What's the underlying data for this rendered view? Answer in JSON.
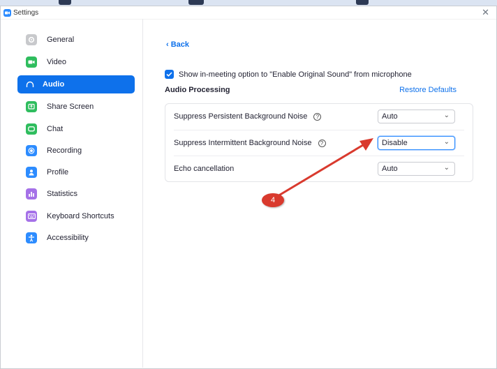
{
  "window": {
    "title": "Settings"
  },
  "sidebar": {
    "items": [
      {
        "label": "General",
        "icon": "gear-icon",
        "color": "#c8c9cc"
      },
      {
        "label": "Video",
        "icon": "video-camera-icon",
        "color": "#2fbd5e"
      },
      {
        "label": "Audio",
        "icon": "headphones-icon",
        "color": "#0e71eb",
        "active": true
      },
      {
        "label": "Share Screen",
        "icon": "share-screen-icon",
        "color": "#2fbd5e"
      },
      {
        "label": "Chat",
        "icon": "chat-bubble-icon",
        "color": "#2fbd5e"
      },
      {
        "label": "Recording",
        "icon": "record-icon",
        "color": "#2d8cff"
      },
      {
        "label": "Profile",
        "icon": "person-icon",
        "color": "#2d8cff"
      },
      {
        "label": "Statistics",
        "icon": "bar-chart-icon",
        "color": "#a571e8"
      },
      {
        "label": "Keyboard Shortcuts",
        "icon": "keyboard-icon",
        "color": "#a571e8"
      },
      {
        "label": "Accessibility",
        "icon": "accessibility-icon",
        "color": "#2d8cff"
      }
    ]
  },
  "main": {
    "back_label": "Back",
    "original_sound_label": "Show in-meeting option to \"Enable Original Sound\" from microphone",
    "original_sound_checked": true,
    "section_title": "Audio Processing",
    "restore_label": "Restore Defaults",
    "rows": [
      {
        "label": "Suppress Persistent Background Noise",
        "value": "Auto"
      },
      {
        "label": "Suppress Intermittent Background Noise",
        "value": "Disable"
      },
      {
        "label": "Echo cancellation",
        "value": "Auto"
      }
    ]
  },
  "annotation": {
    "step": "4",
    "color": "#d93a2e"
  },
  "colors": {
    "accent": "#0e71eb"
  }
}
